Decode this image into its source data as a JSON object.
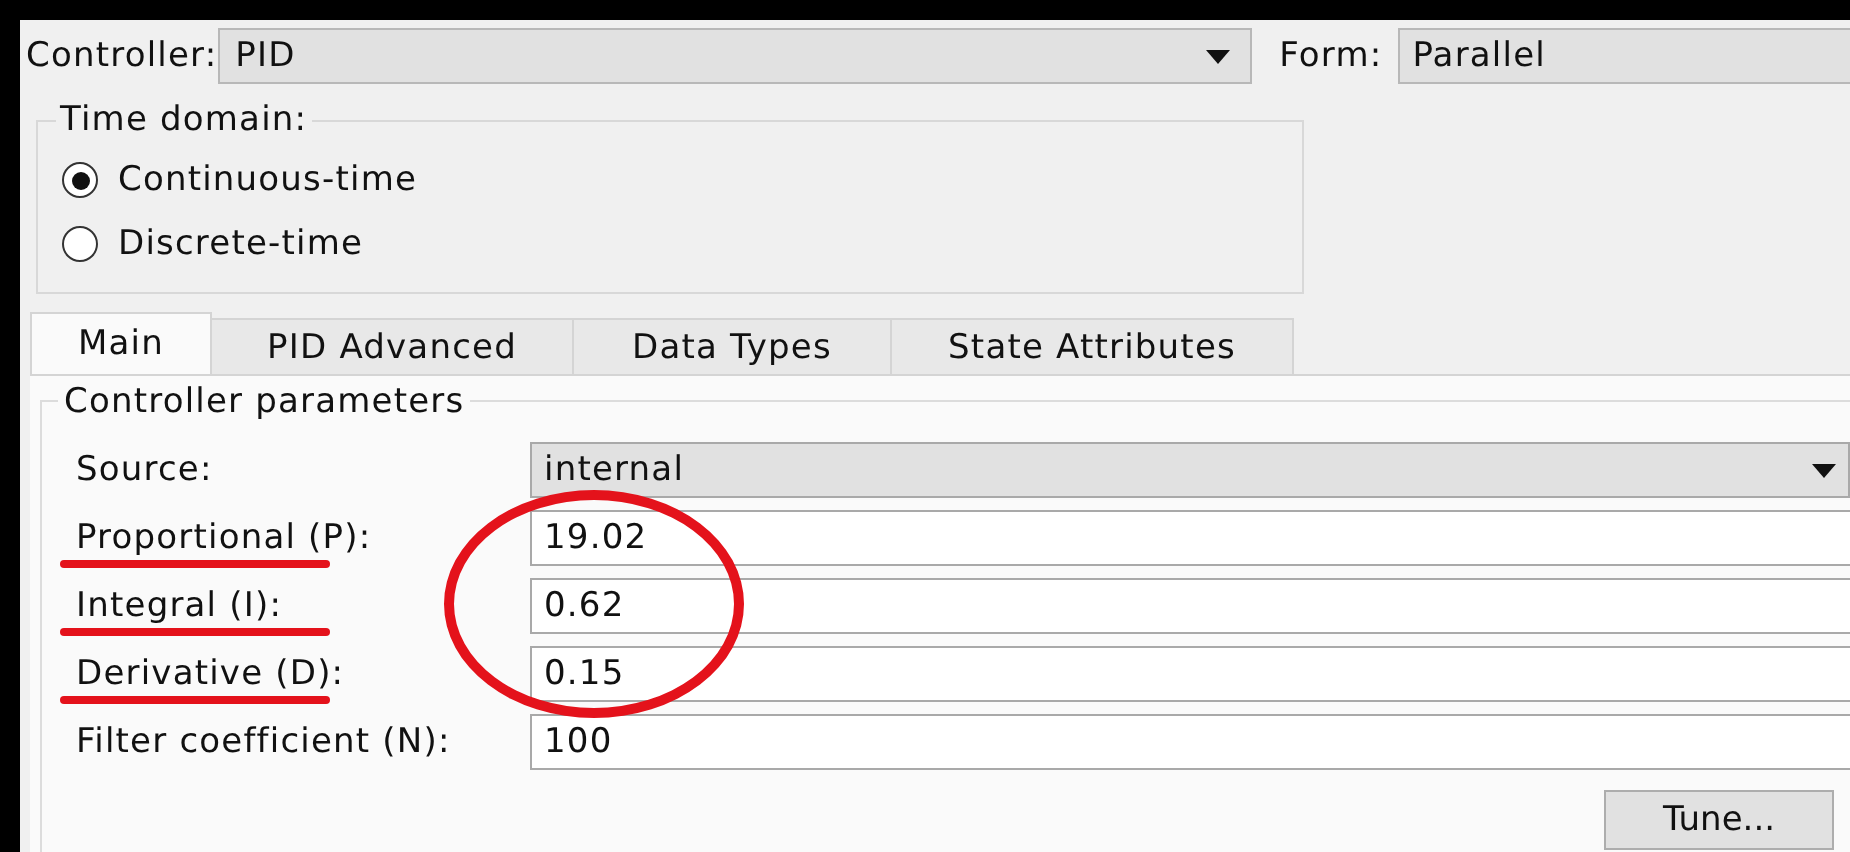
{
  "controller": {
    "label": "Controller:",
    "value": "PID"
  },
  "form": {
    "label": "Form:",
    "value": "Parallel"
  },
  "time_domain": {
    "title": "Time domain:",
    "options": [
      {
        "label": "Continuous-time",
        "selected": true
      },
      {
        "label": "Discrete-time",
        "selected": false
      }
    ]
  },
  "tabs": [
    {
      "label": "Main",
      "selected": true
    },
    {
      "label": "PID Advanced",
      "selected": false
    },
    {
      "label": "Data Types",
      "selected": false
    },
    {
      "label": "State Attributes",
      "selected": false
    }
  ],
  "parameters": {
    "title": "Controller parameters",
    "source": {
      "label": "Source:",
      "value": "internal"
    },
    "fields": [
      {
        "label": "Proportional (P):",
        "value": "19.02",
        "marked": true
      },
      {
        "label": "Integral (I):",
        "value": "0.62",
        "marked": true
      },
      {
        "label": "Derivative (D):",
        "value": "0.15",
        "marked": true
      },
      {
        "label": "Filter coefficient (N):",
        "value": "100",
        "marked": false
      }
    ]
  },
  "buttons": [
    {
      "label": "Tune..."
    }
  ]
}
